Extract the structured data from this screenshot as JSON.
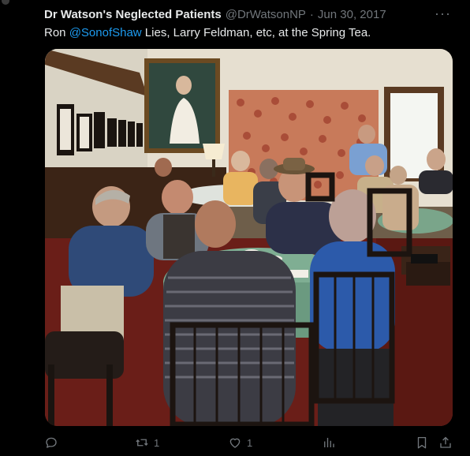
{
  "tweet": {
    "author_name": "Dr Watson's Neglected Patients",
    "author_handle": "@DrWatsonNP",
    "separator": "·",
    "date": "Jun 30, 2017",
    "text_prefix": "Ron ",
    "mention": "@SonofShaw",
    "text_suffix": " Lies, Larry Feldman, etc, at the Spring Tea."
  },
  "menu": {
    "more_glyph": "···"
  },
  "actions": {
    "reply_count": "",
    "retweet_count": "1",
    "like_count": "1"
  },
  "colors": {
    "background": "#000000",
    "text": "#e7e9ea",
    "secondary": "#71767b",
    "link": "#1d9bf0"
  },
  "icons": [
    "reply-icon",
    "retweet-icon",
    "like-icon",
    "views-icon",
    "bookmark-icon",
    "share-icon",
    "more-icon"
  ]
}
